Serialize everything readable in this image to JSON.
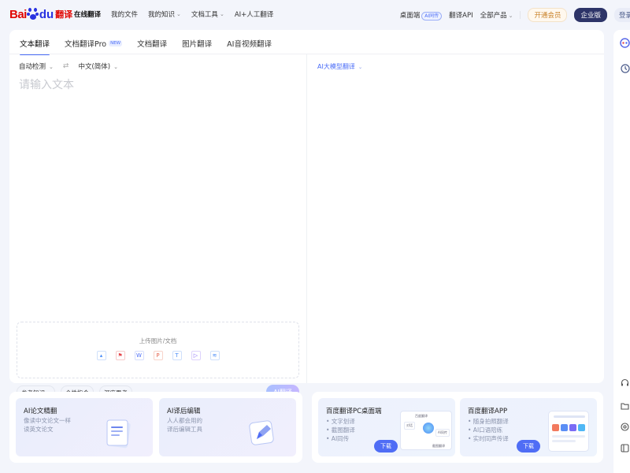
{
  "brand": {
    "bai": "Bai",
    "du": "du",
    "product": "翻译"
  },
  "nav": {
    "items": [
      {
        "label": "在线翻译",
        "active": true,
        "dropdown": false
      },
      {
        "label": "我的文件",
        "active": false,
        "dropdown": false
      },
      {
        "label": "我的知识",
        "active": false,
        "dropdown": true
      },
      {
        "label": "文档工具",
        "active": false,
        "dropdown": true
      },
      {
        "label": "AI+人工翻译",
        "active": false,
        "dropdown": false
      }
    ],
    "dropdown_icon": "chevron-down-icon"
  },
  "header_right": {
    "desktop": "桌面端",
    "desktop_badge": "AI同传",
    "api": "翻译API",
    "all_products": "全部产品",
    "vip": "开通会员",
    "enterprise": "企业版",
    "login": "登录"
  },
  "tabs": [
    {
      "label": "文本翻译",
      "active": true,
      "badge": ""
    },
    {
      "label": "文档翻译Pro",
      "active": false,
      "badge": "NEW"
    },
    {
      "label": "文档翻译",
      "active": false,
      "badge": ""
    },
    {
      "label": "图片翻译",
      "active": false,
      "badge": ""
    },
    {
      "label": "AI音视频翻译",
      "active": false,
      "badge": ""
    }
  ],
  "source": {
    "from_lang": "自动检测",
    "swap_icon": "swap-icon",
    "to_lang": "中文(简体)",
    "placeholder": "请输入文本",
    "upload_title": "上传图片/文档",
    "upload_icons": [
      "image-icon",
      "pdf-icon",
      "word-icon",
      "ppt-icon",
      "txt-icon",
      "video-icon",
      "audio-icon"
    ]
  },
  "options": {
    "knowledge": "参考知识",
    "instruction": "个性指令",
    "deep_think": "深度思考",
    "translate_button": "AI翻译"
  },
  "target": {
    "model": "AI大模型翻译"
  },
  "rail_icons": [
    "assistant-icon",
    "history-icon",
    "headset-icon",
    "folder-icon",
    "settings-icon",
    "collapse-icon"
  ],
  "promos": {
    "paper": {
      "title": "AI论文精翻",
      "sub": [
        "像读中文论文一样",
        "读英文论文"
      ]
    },
    "edit": {
      "title": "AI译后编辑",
      "sub": [
        "人人都会用的",
        "译后编辑工具"
      ]
    },
    "pc": {
      "title": "百度翻译PC桌面端",
      "sub": [
        "• 文字划译",
        "• 截图翻译",
        "• AI同传"
      ],
      "button": "下载",
      "mock_labels": [
        "百度翻译",
        "对话",
        "AI同传",
        "截图翻译"
      ]
    },
    "app": {
      "title": "百度翻译APP",
      "sub": [
        "• 随身拍照翻译",
        "• AI口语陪练",
        "• 实时同声传译"
      ],
      "button": "下载"
    }
  },
  "colors": {
    "accent": "#4a6cf7",
    "brand_red": "#e10602",
    "brand_blue": "#2932e1",
    "enterprise": "#2d3468",
    "vip": "#c9822a"
  }
}
